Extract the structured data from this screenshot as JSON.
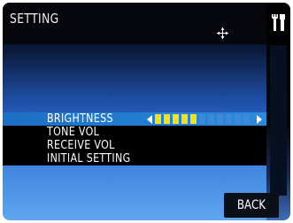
{
  "header": {
    "title": "SETTING",
    "crosshair_icon": "crosshair-icon",
    "tools_icon": "tools-icon"
  },
  "menu": {
    "items": [
      {
        "label": "BRIGHTNESS",
        "selected": true
      },
      {
        "label": "TONE VOL",
        "selected": false
      },
      {
        "label": "RECEIVE VOL",
        "selected": false
      },
      {
        "label": "INITIAL SETTING",
        "selected": false
      }
    ],
    "brightness": {
      "level": 5,
      "max": 11
    }
  },
  "footer": {
    "back_label": "BACK"
  },
  "colors": {
    "selection": "#2a8bdc",
    "slider_on": "#f4e11c",
    "slider_off": "#3e8ad8"
  }
}
